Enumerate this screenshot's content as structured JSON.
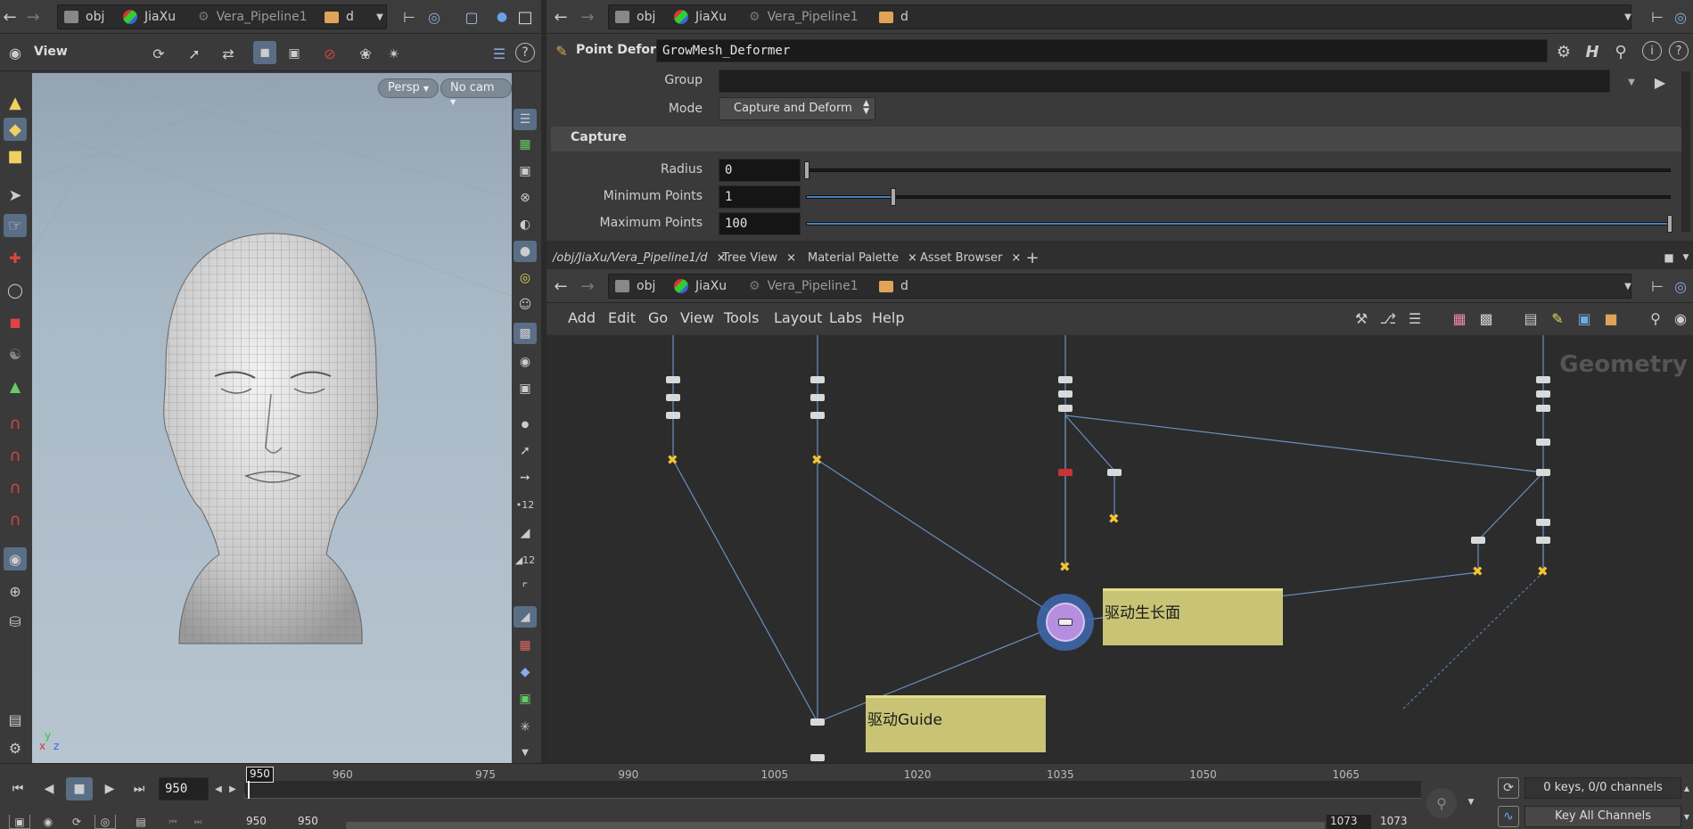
{
  "left_pane": {
    "path": [
      "obj",
      "JiaXu",
      "Vera_Pipeline1",
      "d"
    ],
    "toolbar_title": "View",
    "persp_label": "Persp",
    "cam_label": "No cam",
    "axis_labels": {
      "y": "y",
      "x": "x",
      "z": "z"
    }
  },
  "param_pane": {
    "path": [
      "obj",
      "JiaXu",
      "Vera_Pipeline1",
      "d"
    ],
    "node_type": "Point Deform",
    "node_name": "GrowMesh_Deformer",
    "group_label": "Group",
    "group_value": "",
    "mode_label": "Mode",
    "mode_value": "Capture and Deform",
    "section": "Capture",
    "params": [
      {
        "label": "Radius",
        "value": "0",
        "slider": 0.0
      },
      {
        "label": "Minimum Points",
        "value": "1",
        "slider": 0.1
      },
      {
        "label": "Maximum Points",
        "value": "100",
        "slider": 1.0
      }
    ]
  },
  "network_pane": {
    "tabs": [
      "/obj/JiaXu/Vera_Pipeline1/d",
      "Tree View",
      "Material Palette",
      "Asset Browser"
    ],
    "path": [
      "obj",
      "JiaXu",
      "Vera_Pipeline1",
      "d"
    ],
    "menu": [
      "Add",
      "Edit",
      "Go",
      "View",
      "Tools",
      "Layout",
      "Labs",
      "Help"
    ],
    "context_label": "Geometry",
    "sticky_notes": [
      "驱动生长面",
      "驱动Guide"
    ]
  },
  "timeline": {
    "current_frame": "950",
    "marker_frame": "950",
    "ticks": [
      "960",
      "975",
      "990",
      "1005",
      "1020",
      "1035",
      "1050",
      "1065"
    ],
    "range_start": "950",
    "range_start2": "950",
    "range_end": "1073",
    "range_end2": "1073",
    "keys_status": "0 keys, 0/0 channels",
    "key_all_label": "Key All Channels"
  },
  "colors": {
    "accent": "#4a6fa5",
    "sticky": "#c9c375",
    "node_selected": "#b58ee0"
  }
}
